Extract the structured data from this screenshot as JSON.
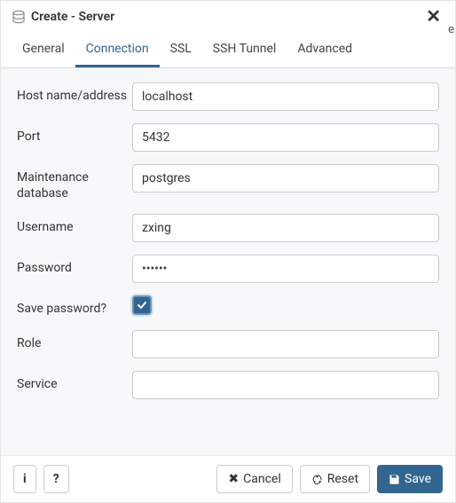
{
  "header": {
    "title": "Create - Server"
  },
  "tabs": {
    "items": [
      {
        "label": "General"
      },
      {
        "label": "Connection"
      },
      {
        "label": "SSL"
      },
      {
        "label": "SSH Tunnel"
      },
      {
        "label": "Advanced"
      }
    ],
    "active": "Connection"
  },
  "form": {
    "host": {
      "label": "Host name/address",
      "value": "localhost"
    },
    "port": {
      "label": "Port",
      "value": "5432"
    },
    "maintenance_db": {
      "label": "Maintenance database",
      "value": "postgres"
    },
    "username": {
      "label": "Username",
      "value": "zxing"
    },
    "password": {
      "label": "Password",
      "value": "••••••"
    },
    "save_password": {
      "label": "Save password?",
      "checked": true
    },
    "role": {
      "label": "Role",
      "value": ""
    },
    "service": {
      "label": "Service",
      "value": ""
    }
  },
  "footer": {
    "info_label": "i",
    "help_label": "?",
    "cancel_label": "Cancel",
    "reset_label": "Reset",
    "save_label": "Save"
  },
  "stray": {
    "char": "e"
  }
}
